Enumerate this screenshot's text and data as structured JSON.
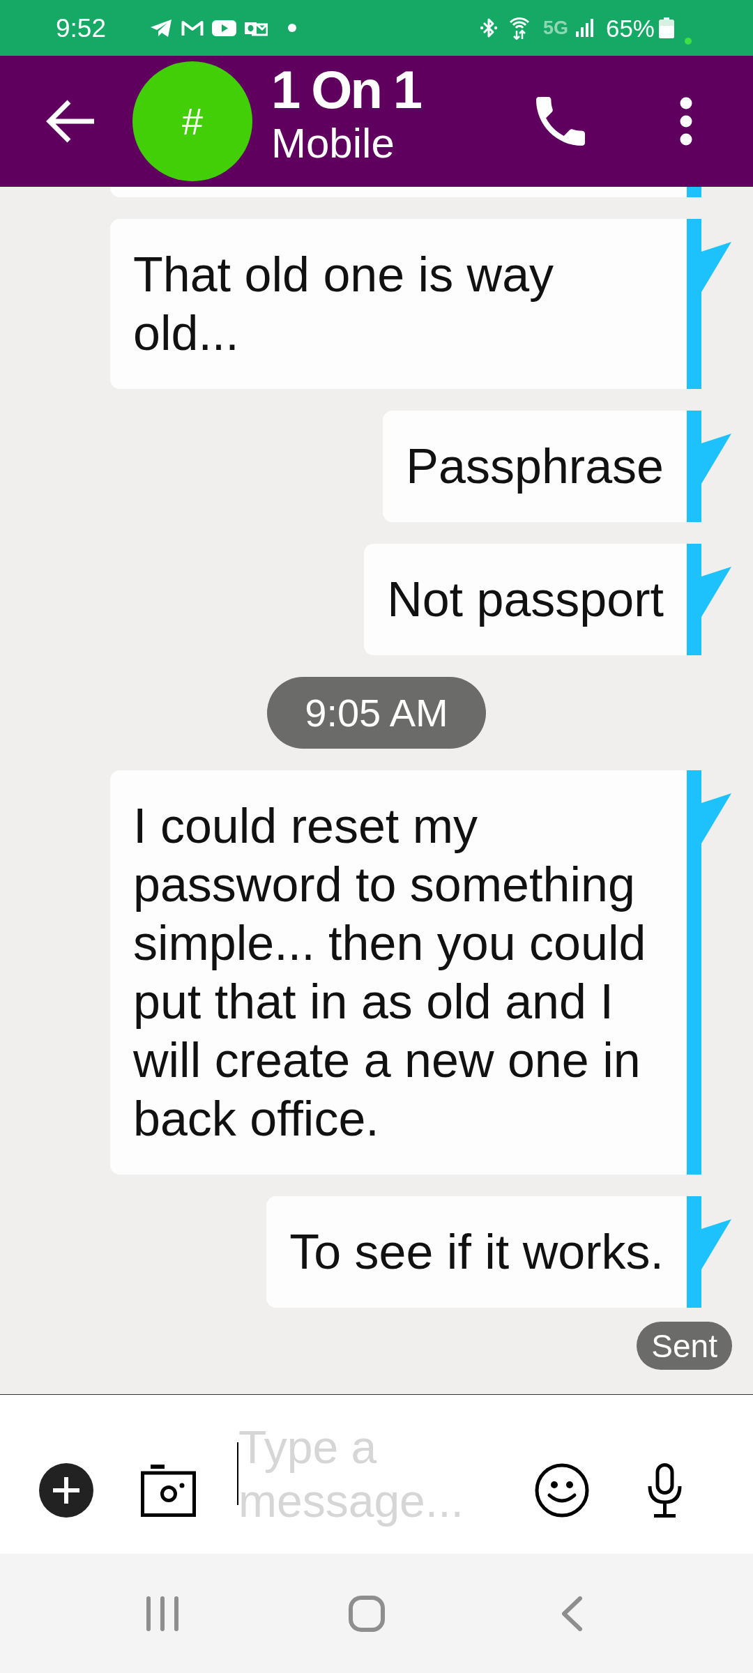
{
  "status_bar": {
    "time": "9:52",
    "network": "5G",
    "battery": "65%"
  },
  "header": {
    "avatar": "#",
    "title": "1 On 1",
    "subtitle": "Mobile"
  },
  "messages": [
    {
      "kind": "clipped"
    },
    {
      "kind": "bubble",
      "text": "That old one is way old..."
    },
    {
      "kind": "bubble",
      "text": "Passphrase"
    },
    {
      "kind": "bubble",
      "text": "Not passport"
    },
    {
      "kind": "time",
      "text": "9:05 AM"
    },
    {
      "kind": "bubble",
      "text": "I could reset my password to something simple... then you could put that in as old and I will create a new one in back office."
    },
    {
      "kind": "bubble",
      "text": "To see if it works."
    }
  ],
  "delivery_status": "Sent",
  "composer": {
    "placeholder": "Type a message..."
  }
}
